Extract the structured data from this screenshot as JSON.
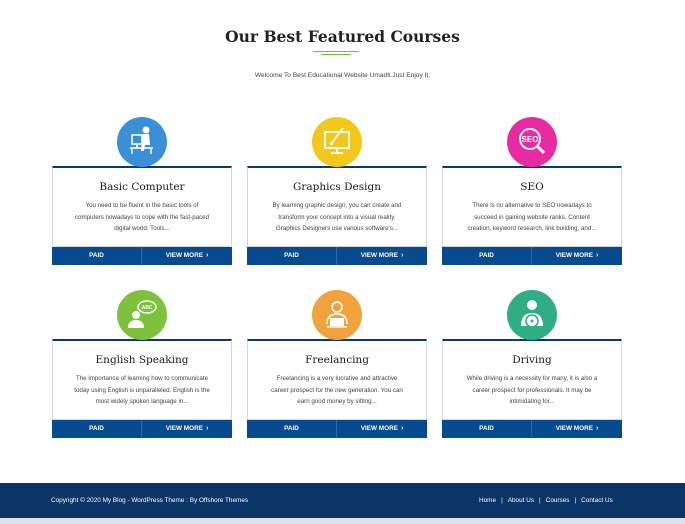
{
  "section": {
    "title": "Our Best Featured Courses",
    "subtitle": "Welcome To Best Educational Website Umadti.Just Enjoy It."
  },
  "colors": {
    "card_border_top": "#0a3a73",
    "button_bar": "#064a8f",
    "footer_bg": "#0a3566",
    "underline": "#6fbf3b"
  },
  "courses": [
    {
      "title": "Basic Computer",
      "icon": "computer-user-icon",
      "icon_color": "#3b8fd9",
      "desc_lines": [
        "You need to be fluent in the basic tools of",
        "computers nowadays to cope with the fast-paced",
        "digital world. Tools..."
      ],
      "price": "PAID",
      "cta": "VIEW MORE"
    },
    {
      "title": "Graphics Design",
      "icon": "design-monitor-icon",
      "icon_color": "#f2c81b",
      "desc_lines": [
        "By learning graphic design, you can create and",
        "transform your concept into a visual reality.",
        "Graphics Designers use various software's..."
      ],
      "price": "PAID",
      "cta": "VIEW MORE"
    },
    {
      "title": "SEO",
      "icon": "seo-magnifier-icon",
      "icon_color": "#e82ba3",
      "desc_lines": [
        "There is no alternative to SEO nowadays to",
        "succeed in gaining website ranks. Content",
        "creation, keyword research, link building, and..."
      ],
      "price": "PAID",
      "cta": "VIEW MORE"
    },
    {
      "title": "English Speaking",
      "icon": "speech-bubble-abc-icon",
      "icon_color": "#7dc13c",
      "desc_lines": [
        "The importance of learning how to communicate",
        "today using English is unparalleled. English is the",
        "most widely spoken language in..."
      ],
      "price": "PAID",
      "cta": "VIEW MORE"
    },
    {
      "title": "Freelancing",
      "icon": "freelancer-laptop-icon",
      "icon_color": "#f2a23c",
      "desc_lines": [
        "Freelancing is a very lucrative and attractive",
        "career prospect for the new generation. You can",
        "earn good money by sitting..."
      ],
      "price": "PAID",
      "cta": "VIEW MORE"
    },
    {
      "title": "Driving",
      "icon": "driver-steering-icon",
      "icon_color": "#2fae82",
      "desc_lines": [
        "While driving is a necessity for many, it is also a",
        "career prospect for professionals. It may be",
        "intimidating for..."
      ],
      "price": "PAID",
      "cta": "VIEW MORE"
    }
  ],
  "footer": {
    "copyright": "Copyright © 2020 My Blog - WordPress Theme : By  Offshore Themes",
    "links": [
      "Home",
      "About Us",
      "Courses",
      "Contact Us"
    ]
  }
}
